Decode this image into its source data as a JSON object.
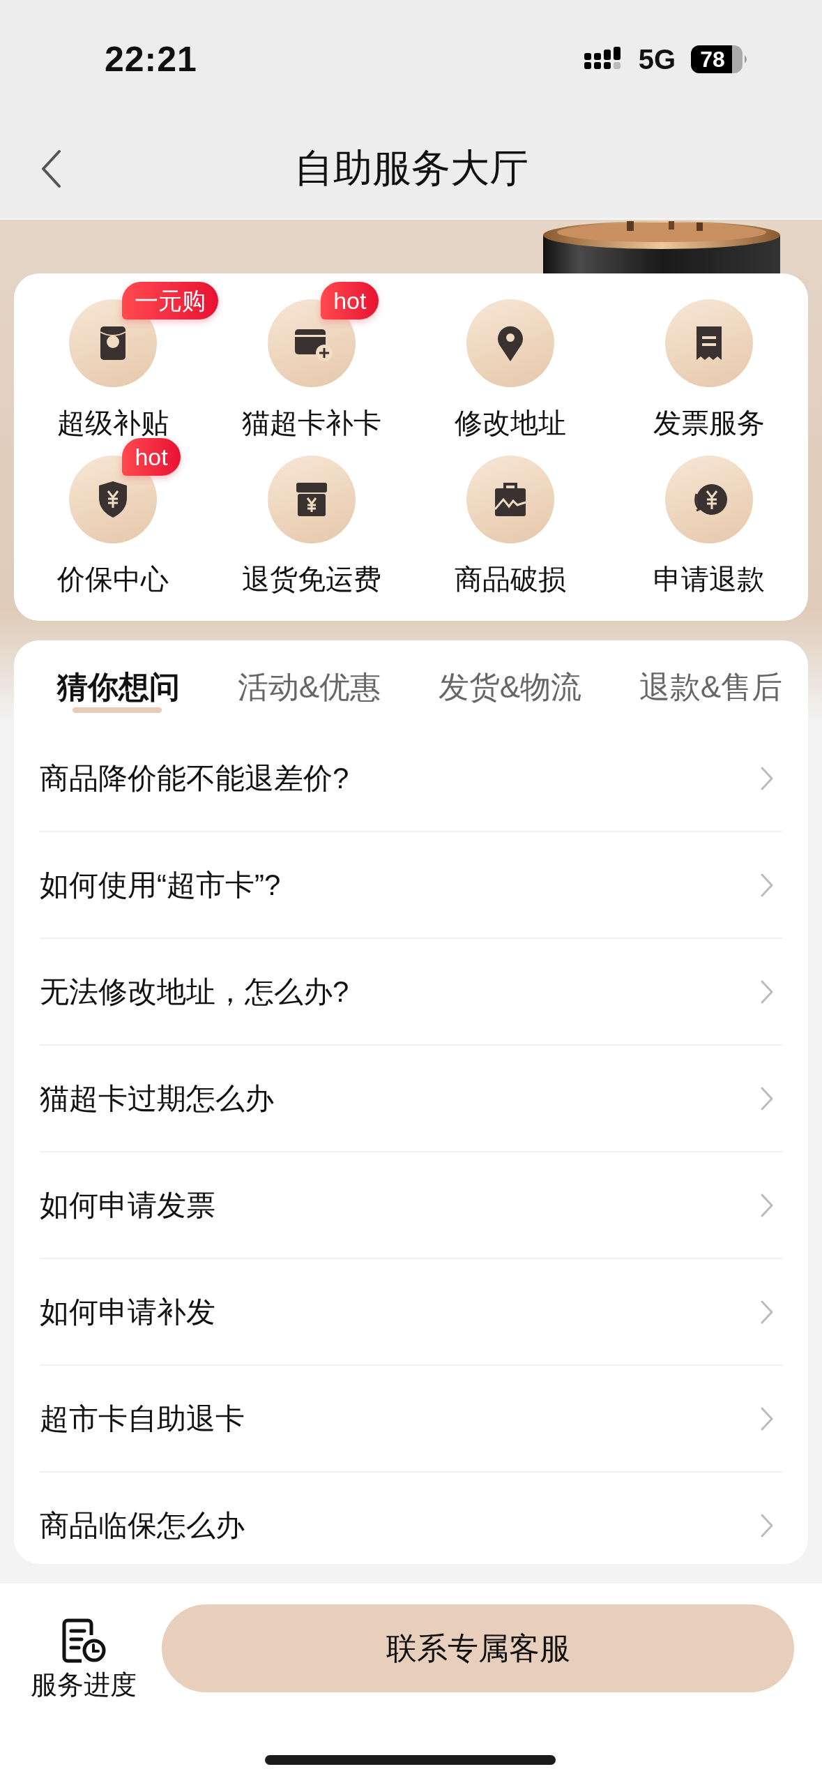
{
  "status_bar": {
    "time": "22:21",
    "network": "5G",
    "battery": "78"
  },
  "nav_bar": {
    "title": "自助服务大厅"
  },
  "services": [
    {
      "label": "超级补贴",
      "badge": "一元购"
    },
    {
      "label": "猫超卡补卡",
      "badge": "hot"
    },
    {
      "label": "修改地址"
    },
    {
      "label": "发票服务"
    },
    {
      "label": "价保中心",
      "badge": "hot"
    },
    {
      "label": "退货免运费"
    },
    {
      "label": "商品破损"
    },
    {
      "label": "申请退款"
    }
  ],
  "tabs": [
    {
      "label": "猜你想问",
      "selected": true
    },
    {
      "label": "活动&优惠",
      "selected": false
    },
    {
      "label": "发货&物流",
      "selected": false
    },
    {
      "label": "退款&售后",
      "selected": false
    }
  ],
  "questions": [
    "商品降价能不能退差价?",
    "如何使用“超市卡”?",
    "无法修改地址，怎么办?",
    "猫超卡过期怎么办",
    "如何申请发票",
    "如何申请补发",
    "超市卡自助退卡",
    "商品临保怎么办"
  ],
  "bottom_bar": {
    "progress_label": "服务进度",
    "contact_button": "联系专属客服"
  }
}
